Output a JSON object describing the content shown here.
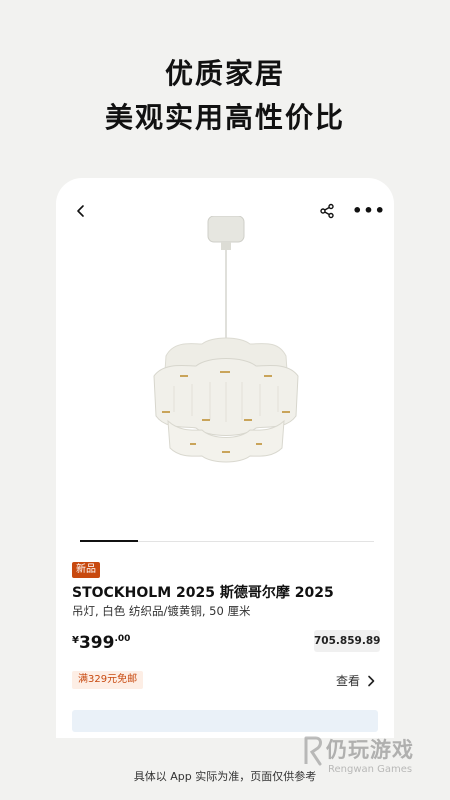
{
  "headline": {
    "line1": "优质家居",
    "line2": "美观实用高性价比"
  },
  "nav": {
    "back_icon": "chevron-left-icon",
    "share_icon": "share-icon",
    "more_label": "•••"
  },
  "gallery": {
    "active_index": 0
  },
  "product": {
    "badge": "新品",
    "title": "STOCKHOLM 2025 斯德哥尔摩 2025",
    "subtitle": "吊灯, 白色 纺织品/镀黄铜, 50 厘米",
    "price_currency": "¥",
    "price_integer": "399",
    "price_decimal": ".00",
    "article_number": "705.859.89",
    "shipping_tag": "满329元免邮",
    "view_label": "查看"
  },
  "colors": {
    "accent_orange": "#c8490f",
    "background": "#f2f2f0"
  },
  "footnote": "具体以 App 实际为准，页面仅供参考",
  "watermark": {
    "name": "仍玩游戏",
    "sub": "Rengwan Games"
  }
}
